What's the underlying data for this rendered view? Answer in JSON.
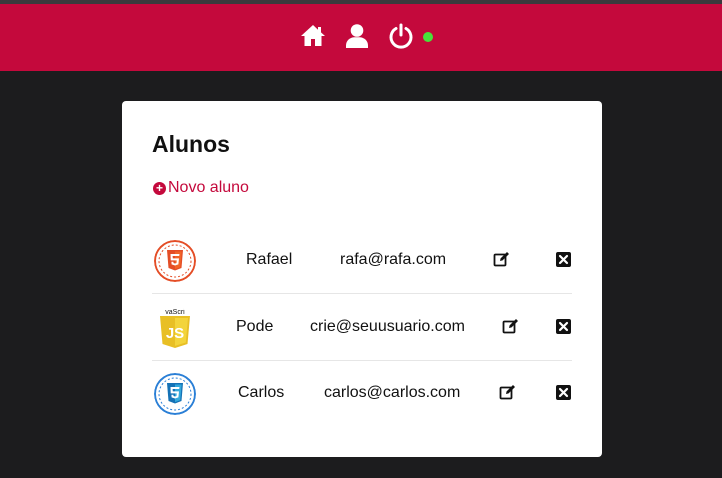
{
  "header": {
    "icons": [
      "home-icon",
      "user-icon",
      "power-icon"
    ],
    "status_color": "#48e23a",
    "brand_color": "#c4093c"
  },
  "page": {
    "title": "Alunos",
    "new_student_label": "Novo aluno"
  },
  "students": [
    {
      "name": "Rafael",
      "email": "rafa@rafa.com",
      "avatar": "html5-logo"
    },
    {
      "name": "Pode",
      "email": "crie@seuusuario.com",
      "avatar": "javascript-logo"
    },
    {
      "name": "Carlos",
      "email": "carlos@carlos.com",
      "avatar": "css3-logo"
    }
  ],
  "actions": [
    "edit-icon",
    "delete-icon"
  ]
}
